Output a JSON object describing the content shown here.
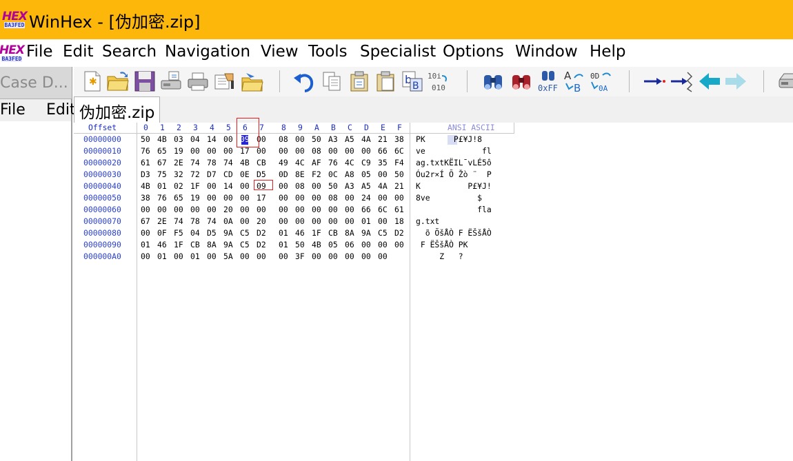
{
  "app": {
    "logo_line1": "HEX",
    "logo_line2": "BA3FED",
    "title": "WinHex - [伪加密.zip]"
  },
  "menu": [
    "File",
    "Edit",
    "Search",
    "Navigation",
    "View",
    "Tools",
    "Specialist",
    "Options",
    "Window",
    "Help"
  ],
  "case_panel": {
    "tab_label": "Case D...",
    "menu": [
      "File",
      "Edit"
    ]
  },
  "toolbar": {
    "icons": [
      "new-file-icon",
      "open-folder-icon",
      "save-icon",
      "save-disk-icon",
      "print-icon",
      "properties-icon",
      "open-folder-arrow-icon",
      "undo-icon",
      "copy-block-icon",
      "cut-icon",
      "paste-icon",
      "paste-special-icon",
      "write-bits-icon",
      "find-text-icon",
      "find-hex-icon",
      "find-value-icon",
      "replace-text-icon",
      "replace-hex-icon",
      "goto-offset-icon",
      "goto-sector-icon",
      "back-icon",
      "forward-icon",
      "disk-icon"
    ]
  },
  "document_tab": {
    "label": "伪加密.zip"
  },
  "hex": {
    "offset_header": "Offset",
    "columns": [
      "0",
      "1",
      "2",
      "3",
      "4",
      "5",
      "6",
      "7",
      "8",
      "9",
      "A",
      "B",
      "C",
      "D",
      "E",
      "F"
    ],
    "text_header": "ANSI ASCII",
    "rows": [
      {
        "offset": "00000000",
        "bytes": [
          "50",
          "4B",
          "03",
          "04",
          "14",
          "00",
          "09",
          "00",
          "08",
          "00",
          "50",
          "A3",
          "A5",
          "4A",
          "21",
          "38"
        ],
        "text": "PK      P£¥J!8"
      },
      {
        "offset": "00000010",
        "bytes": [
          "76",
          "65",
          "19",
          "00",
          "00",
          "00",
          "17",
          "00",
          "00",
          "00",
          "08",
          "00",
          "00",
          "00",
          "66",
          "6C"
        ],
        "text": "ve            fl"
      },
      {
        "offset": "00000020",
        "bytes": [
          "61",
          "67",
          "2E",
          "74",
          "78",
          "74",
          "4B",
          "CB",
          "49",
          "4C",
          "AF",
          "76",
          "4C",
          "C9",
          "35",
          "F4"
        ],
        "text": "ag.txtKËIL¯vLÉ5ô"
      },
      {
        "offset": "00000030",
        "bytes": [
          "D3",
          "75",
          "32",
          "72",
          "D7",
          "CD",
          "0E",
          "D5",
          "0D",
          "8E",
          "F2",
          "0C",
          "A8",
          "05",
          "00",
          "50"
        ],
        "text": "Óu2r×Í Õ Žò ¨  P"
      },
      {
        "offset": "00000040",
        "bytes": [
          "4B",
          "01",
          "02",
          "1F",
          "00",
          "14",
          "00",
          "09",
          "00",
          "08",
          "00",
          "50",
          "A3",
          "A5",
          "4A",
          "21"
        ],
        "text": "K          P£¥J!"
      },
      {
        "offset": "00000050",
        "bytes": [
          "38",
          "76",
          "65",
          "19",
          "00",
          "00",
          "00",
          "17",
          "00",
          "00",
          "00",
          "08",
          "00",
          "24",
          "00",
          "00"
        ],
        "text": "8ve          $  "
      },
      {
        "offset": "00000060",
        "bytes": [
          "00",
          "00",
          "00",
          "00",
          "00",
          "20",
          "00",
          "00",
          "00",
          "00",
          "00",
          "00",
          "00",
          "66",
          "6C",
          "61"
        ],
        "text": "             fla"
      },
      {
        "offset": "00000070",
        "bytes": [
          "67",
          "2E",
          "74",
          "78",
          "74",
          "0A",
          "00",
          "20",
          "00",
          "00",
          "00",
          "00",
          "00",
          "01",
          "00",
          "18"
        ],
        "text": "g.txt"
      },
      {
        "offset": "00000080",
        "bytes": [
          "00",
          "0F",
          "F5",
          "04",
          "D5",
          "9A",
          "C5",
          "D2",
          "01",
          "46",
          "1F",
          "CB",
          "8A",
          "9A",
          "C5",
          "D2"
        ],
        "text": "  õ ÕšÅÒ F ËŠšÅÒ"
      },
      {
        "offset": "00000090",
        "bytes": [
          "01",
          "46",
          "1F",
          "CB",
          "8A",
          "9A",
          "C5",
          "D2",
          "01",
          "50",
          "4B",
          "05",
          "06",
          "00",
          "00",
          "00"
        ],
        "text": " F ËŠšÅÒ PK"
      },
      {
        "offset": "000000A0",
        "bytes": [
          "00",
          "01",
          "00",
          "01",
          "00",
          "5A",
          "00",
          "00",
          "00",
          "3F",
          "00",
          "00",
          "00",
          "00",
          "00"
        ],
        "text": "     Z   ?"
      }
    ]
  },
  "colors": {
    "titlebar": "#fdb70a",
    "offset_text": "#2b40d0",
    "marker": "#e81e1e",
    "selection": "#2525d2"
  }
}
